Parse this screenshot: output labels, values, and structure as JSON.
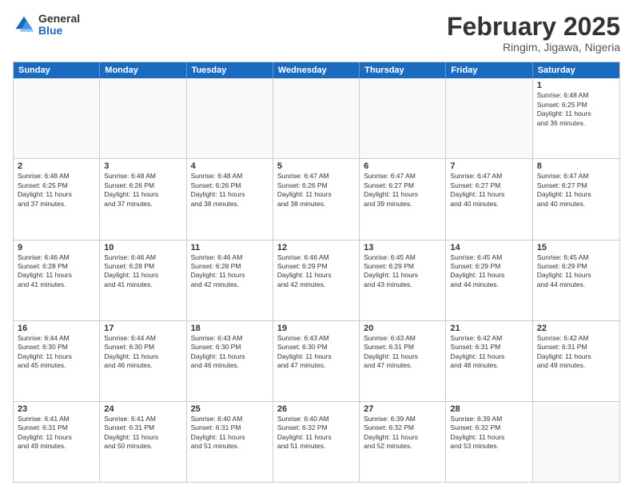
{
  "header": {
    "logo_general": "General",
    "logo_blue": "Blue",
    "month_title": "February 2025",
    "location": "Ringim, Jigawa, Nigeria"
  },
  "calendar": {
    "days_of_week": [
      "Sunday",
      "Monday",
      "Tuesday",
      "Wednesday",
      "Thursday",
      "Friday",
      "Saturday"
    ],
    "weeks": [
      [
        {
          "day": "",
          "info": "",
          "empty": true
        },
        {
          "day": "",
          "info": "",
          "empty": true
        },
        {
          "day": "",
          "info": "",
          "empty": true
        },
        {
          "day": "",
          "info": "",
          "empty": true
        },
        {
          "day": "",
          "info": "",
          "empty": true
        },
        {
          "day": "",
          "info": "",
          "empty": true
        },
        {
          "day": "1",
          "info": "Sunrise: 6:48 AM\nSunset: 6:25 PM\nDaylight: 11 hours\nand 36 minutes.",
          "empty": false
        }
      ],
      [
        {
          "day": "2",
          "info": "Sunrise: 6:48 AM\nSunset: 6:25 PM\nDaylight: 11 hours\nand 37 minutes.",
          "empty": false
        },
        {
          "day": "3",
          "info": "Sunrise: 6:48 AM\nSunset: 6:26 PM\nDaylight: 11 hours\nand 37 minutes.",
          "empty": false
        },
        {
          "day": "4",
          "info": "Sunrise: 6:48 AM\nSunset: 6:26 PM\nDaylight: 11 hours\nand 38 minutes.",
          "empty": false
        },
        {
          "day": "5",
          "info": "Sunrise: 6:47 AM\nSunset: 6:26 PM\nDaylight: 11 hours\nand 38 minutes.",
          "empty": false
        },
        {
          "day": "6",
          "info": "Sunrise: 6:47 AM\nSunset: 6:27 PM\nDaylight: 11 hours\nand 39 minutes.",
          "empty": false
        },
        {
          "day": "7",
          "info": "Sunrise: 6:47 AM\nSunset: 6:27 PM\nDaylight: 11 hours\nand 40 minutes.",
          "empty": false
        },
        {
          "day": "8",
          "info": "Sunrise: 6:47 AM\nSunset: 6:27 PM\nDaylight: 11 hours\nand 40 minutes.",
          "empty": false
        }
      ],
      [
        {
          "day": "9",
          "info": "Sunrise: 6:46 AM\nSunset: 6:28 PM\nDaylight: 11 hours\nand 41 minutes.",
          "empty": false
        },
        {
          "day": "10",
          "info": "Sunrise: 6:46 AM\nSunset: 6:28 PM\nDaylight: 11 hours\nand 41 minutes.",
          "empty": false
        },
        {
          "day": "11",
          "info": "Sunrise: 6:46 AM\nSunset: 6:28 PM\nDaylight: 11 hours\nand 42 minutes.",
          "empty": false
        },
        {
          "day": "12",
          "info": "Sunrise: 6:46 AM\nSunset: 6:29 PM\nDaylight: 11 hours\nand 42 minutes.",
          "empty": false
        },
        {
          "day": "13",
          "info": "Sunrise: 6:45 AM\nSunset: 6:29 PM\nDaylight: 11 hours\nand 43 minutes.",
          "empty": false
        },
        {
          "day": "14",
          "info": "Sunrise: 6:45 AM\nSunset: 6:29 PM\nDaylight: 11 hours\nand 44 minutes.",
          "empty": false
        },
        {
          "day": "15",
          "info": "Sunrise: 6:45 AM\nSunset: 6:29 PM\nDaylight: 11 hours\nand 44 minutes.",
          "empty": false
        }
      ],
      [
        {
          "day": "16",
          "info": "Sunrise: 6:44 AM\nSunset: 6:30 PM\nDaylight: 11 hours\nand 45 minutes.",
          "empty": false
        },
        {
          "day": "17",
          "info": "Sunrise: 6:44 AM\nSunset: 6:30 PM\nDaylight: 11 hours\nand 46 minutes.",
          "empty": false
        },
        {
          "day": "18",
          "info": "Sunrise: 6:43 AM\nSunset: 6:30 PM\nDaylight: 11 hours\nand 46 minutes.",
          "empty": false
        },
        {
          "day": "19",
          "info": "Sunrise: 6:43 AM\nSunset: 6:30 PM\nDaylight: 11 hours\nand 47 minutes.",
          "empty": false
        },
        {
          "day": "20",
          "info": "Sunrise: 6:43 AM\nSunset: 6:31 PM\nDaylight: 11 hours\nand 47 minutes.",
          "empty": false
        },
        {
          "day": "21",
          "info": "Sunrise: 6:42 AM\nSunset: 6:31 PM\nDaylight: 11 hours\nand 48 minutes.",
          "empty": false
        },
        {
          "day": "22",
          "info": "Sunrise: 6:42 AM\nSunset: 6:31 PM\nDaylight: 11 hours\nand 49 minutes.",
          "empty": false
        }
      ],
      [
        {
          "day": "23",
          "info": "Sunrise: 6:41 AM\nSunset: 6:31 PM\nDaylight: 11 hours\nand 49 minutes.",
          "empty": false
        },
        {
          "day": "24",
          "info": "Sunrise: 6:41 AM\nSunset: 6:31 PM\nDaylight: 11 hours\nand 50 minutes.",
          "empty": false
        },
        {
          "day": "25",
          "info": "Sunrise: 6:40 AM\nSunset: 6:31 PM\nDaylight: 11 hours\nand 51 minutes.",
          "empty": false
        },
        {
          "day": "26",
          "info": "Sunrise: 6:40 AM\nSunset: 6:32 PM\nDaylight: 11 hours\nand 51 minutes.",
          "empty": false
        },
        {
          "day": "27",
          "info": "Sunrise: 6:39 AM\nSunset: 6:32 PM\nDaylight: 11 hours\nand 52 minutes.",
          "empty": false
        },
        {
          "day": "28",
          "info": "Sunrise: 6:39 AM\nSunset: 6:32 PM\nDaylight: 11 hours\nand 53 minutes.",
          "empty": false
        },
        {
          "day": "",
          "info": "",
          "empty": true
        }
      ]
    ]
  }
}
